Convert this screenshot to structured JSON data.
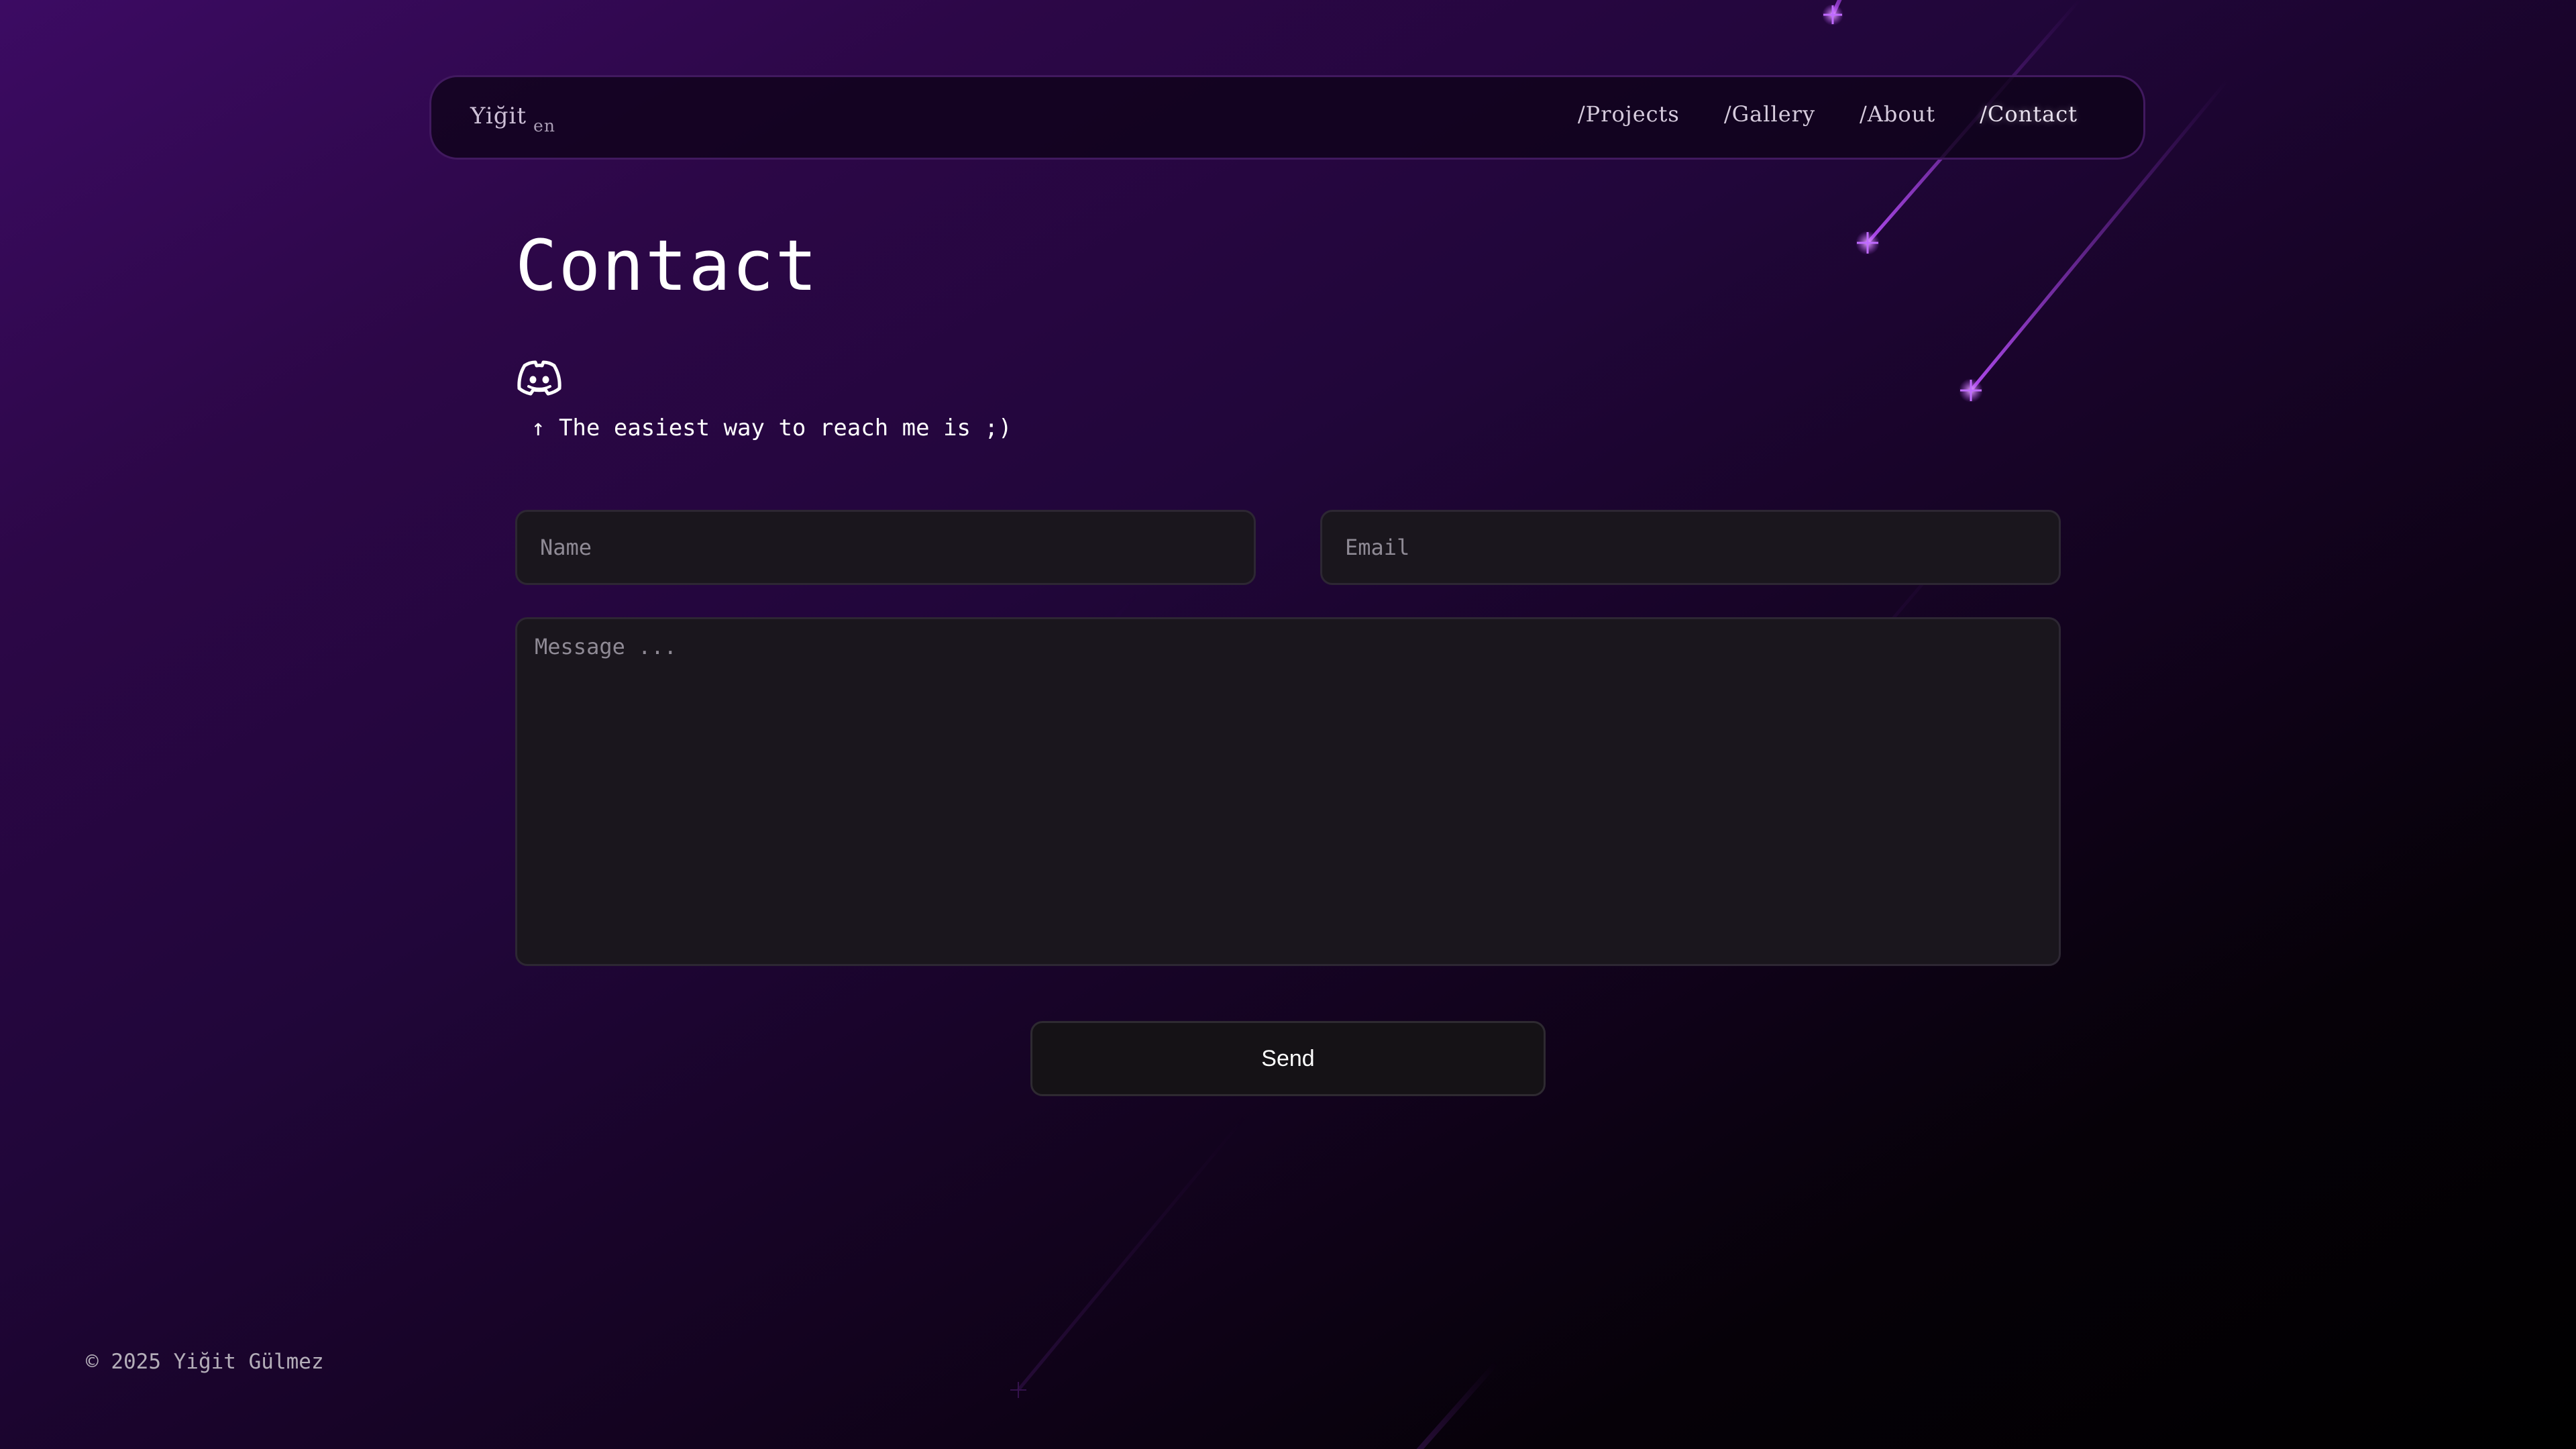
{
  "header": {
    "brand": "Yiğit",
    "language": "en",
    "nav": [
      {
        "label": "/Projects"
      },
      {
        "label": "/Gallery"
      },
      {
        "label": "/About"
      },
      {
        "label": "/Contact",
        "active": true
      }
    ]
  },
  "main": {
    "title": "Contact",
    "contact_icon": "discord-icon",
    "hint": "↑ The easiest way to reach me is ;)",
    "form": {
      "name_placeholder": "Name",
      "email_placeholder": "Email",
      "message_placeholder": "Message ...",
      "send_label": "Send"
    }
  },
  "footer": {
    "copyright": "© 2025 Yiğit Gülmez"
  },
  "colors": {
    "accent": "#b44cf5",
    "background_top": "#3c0b63",
    "background_bottom": "#000000",
    "field_background": "#1a161d"
  }
}
